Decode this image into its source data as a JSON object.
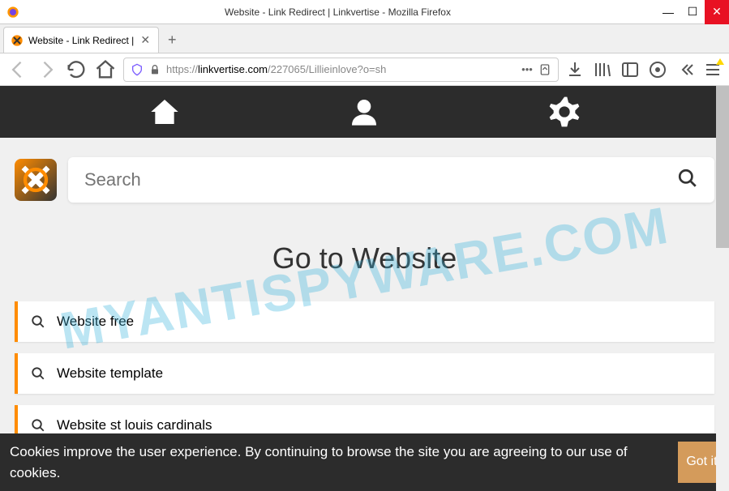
{
  "window": {
    "title": "Website - Link Redirect | Linkvertise - Mozilla Firefox"
  },
  "tab": {
    "title": "Website - Link Redirect |"
  },
  "url": {
    "protocol": "https://",
    "domain": "linkvertise.com",
    "path": "/227065/Lillieinlove?o=sh"
  },
  "search": {
    "placeholder": "Search"
  },
  "page": {
    "heading": "Go to Website"
  },
  "suggestions": [
    {
      "label": "Website free"
    },
    {
      "label": "Website template"
    },
    {
      "label": "Website st louis cardinals"
    }
  ],
  "cookie": {
    "text": "Cookies improve the user experience. By continuing to browse the site you are agreeing to our use of cookies.",
    "button": "Got it!"
  },
  "watermark": "MYANTISPYWARE.COM"
}
